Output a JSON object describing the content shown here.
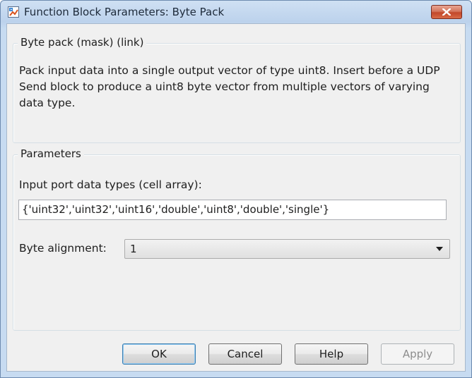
{
  "window": {
    "title": "Function Block Parameters: Byte Pack",
    "close_icon": "close-icon"
  },
  "description_group": {
    "legend": "Byte pack (mask) (link)",
    "text": "Pack input data into a single output vector of type uint8. Insert before a UDP Send block to produce a uint8 byte vector from multiple vectors of varying data type."
  },
  "parameters_group": {
    "legend": "Parameters",
    "input_types_label": "Input port data types (cell array):",
    "input_types_value": "{'uint32','uint32','uint16','double','uint8','double','single'}",
    "byte_alignment_label": "Byte alignment:",
    "byte_alignment_value": "1"
  },
  "buttons": {
    "ok": "OK",
    "cancel": "Cancel",
    "help": "Help",
    "apply": "Apply"
  },
  "colors": {
    "titlebar": "#bcd2ec",
    "close_button": "#c2472a",
    "dialog_background": "#f0f0f0",
    "default_button_border": "#3c7fb1"
  }
}
